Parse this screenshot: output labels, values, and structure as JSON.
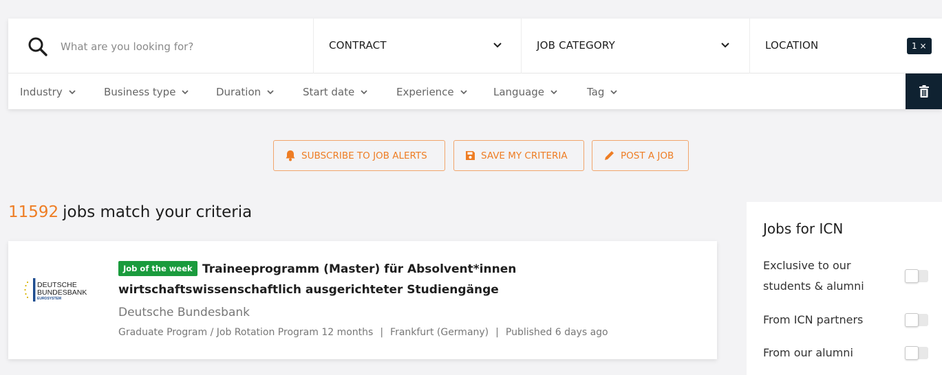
{
  "search": {
    "placeholder": "What are you looking for?",
    "value": ""
  },
  "dropdowns": {
    "contract": "CONTRACT",
    "job_category": "JOB CATEGORY",
    "location": "LOCATION",
    "location_badge": "1 ×"
  },
  "filters": [
    "Industry",
    "Business type",
    "Duration",
    "Start date",
    "Experience",
    "Language",
    "Tag"
  ],
  "actions": {
    "subscribe": "SUBSCRIBE TO JOB ALERTS",
    "save": "SAVE MY CRITERIA",
    "post": "POST A JOB"
  },
  "results": {
    "count": "11592",
    "label": "jobs match your criteria"
  },
  "job": {
    "badge": "Job of the week",
    "title": "Traineeprogramm (Master) für Absolvent*innen wirtschaftswissenschaftlich ausgerichteter Studiengänge",
    "company": "Deutsche Bundesbank",
    "contract": "Graduate Program / Job Rotation Program 12 months",
    "location": "Frankfurt (Germany)",
    "published": "Published 6 days ago",
    "separator": "|",
    "logo": {
      "line1": "DEUTSCHE",
      "line2": "BUNDESBANK",
      "line3": "EUROSYSTEM"
    }
  },
  "sidebar": {
    "title": "Jobs for ICN",
    "items": [
      {
        "label": "Exclusive to our students & alumni",
        "on": false
      },
      {
        "label": "From ICN partners",
        "on": false
      },
      {
        "label": "From our alumni",
        "on": false
      }
    ]
  },
  "colors": {
    "accent": "#ee7d24",
    "dark": "#0f2231",
    "badge_green": "#1a9b3d"
  }
}
